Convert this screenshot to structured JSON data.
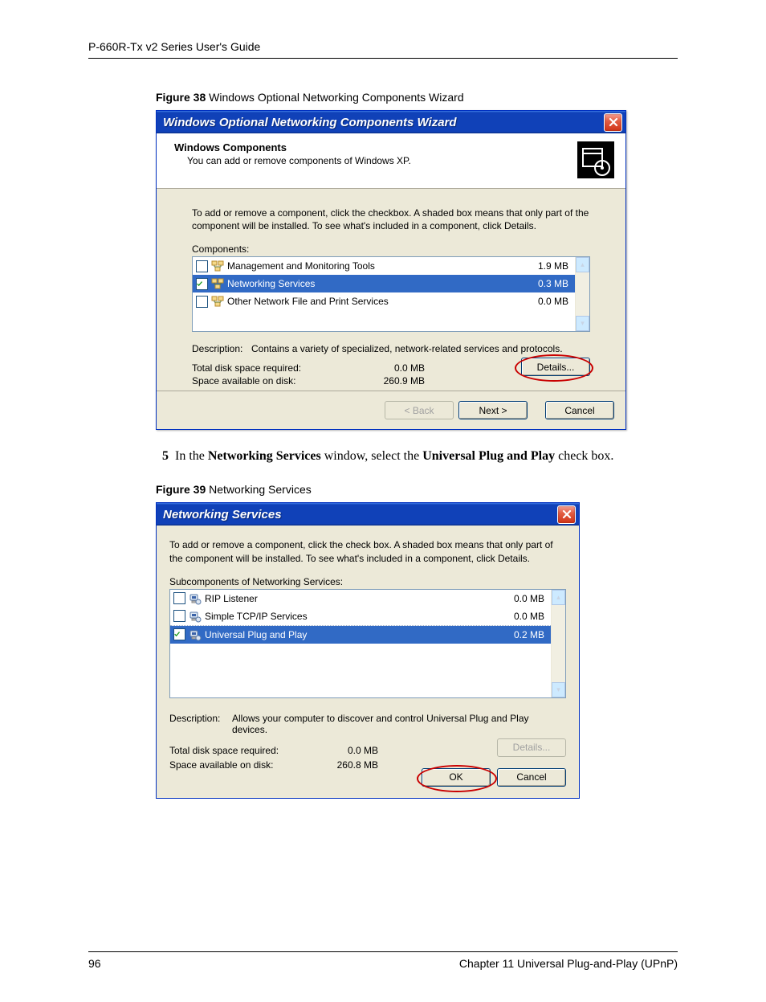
{
  "header_text": "P-660R-Tx v2 Series User's Guide",
  "figure38": {
    "label_strong": "Figure 38",
    "label_rest": "   Windows Optional Networking Components Wizard"
  },
  "dialog1": {
    "title": "Windows Optional Networking Components Wizard",
    "header_title": "Windows Components",
    "header_sub": "You can add or remove components of Windows XP.",
    "instruction": "To add or remove a component, click the checkbox.  A shaded box means that only part of the component will be installed.  To see what's included in a component, click Details.",
    "components_label": "Components:",
    "items": [
      {
        "checked": false,
        "label": "Management and Monitoring Tools",
        "size": "1.9 MB",
        "selected": false
      },
      {
        "checked": true,
        "label": "Networking Services",
        "size": "0.3 MB",
        "selected": true
      },
      {
        "checked": false,
        "label": "Other Network File and Print Services",
        "size": "0.0 MB",
        "selected": false
      }
    ],
    "description_label": "Description:",
    "description_text": "Contains a variety of specialized, network-related services and protocols.",
    "total_label": "Total disk space required:",
    "total_val": "0.0 MB",
    "avail_label": "Space available on disk:",
    "avail_val": "260.9 MB",
    "details_btn": "Details...",
    "back_btn": "< Back",
    "next_btn": "Next >",
    "cancel_btn": "Cancel"
  },
  "step5": {
    "num": "5",
    "pre": "In the ",
    "b1": "Networking Services",
    "mid": " window, select the ",
    "b2": "Universal Plug and Play",
    "post": " check box."
  },
  "figure39": {
    "label_strong": "Figure 39",
    "label_rest": "   Networking Services"
  },
  "dialog2": {
    "title": "Networking Services",
    "instruction": "To add or remove a component, click the check box. A shaded box means that only part of the component will be installed. To see what's included in a component, click Details.",
    "sub_label": "Subcomponents of Networking Services:",
    "items": [
      {
        "checked": false,
        "label": "RIP Listener",
        "size": "0.0 MB",
        "selected": false,
        "dotted": false
      },
      {
        "checked": false,
        "label": "Simple TCP/IP Services",
        "size": "0.0 MB",
        "selected": false,
        "dotted": true
      },
      {
        "checked": true,
        "label": "Universal Plug and Play",
        "size": "0.2 MB",
        "selected": true,
        "dotted": false
      }
    ],
    "description_label": "Description:",
    "description_text": "Allows your computer to discover and control Universal Plug and Play devices.",
    "total_label": "Total disk space required:",
    "total_val": "0.0 MB",
    "avail_label": "Space available on disk:",
    "avail_val": "260.8 MB",
    "details_btn": "Details...",
    "ok_btn": "OK",
    "cancel_btn": "Cancel"
  },
  "footer": {
    "page_num": "96",
    "chapter": "Chapter 11 Universal Plug-and-Play (UPnP)"
  }
}
